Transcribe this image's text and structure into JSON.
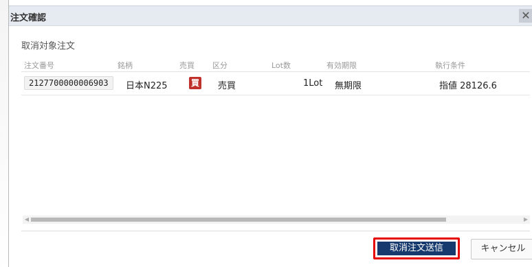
{
  "dialog": {
    "title": "注文確認",
    "close_glyph": "✕",
    "subtitle": "取消対象注文"
  },
  "table": {
    "columns": [
      "注文番号",
      "銘柄",
      "売買",
      "区分",
      "Lot数",
      "有効期限",
      "執行条件"
    ],
    "rows": [
      {
        "order_no": "2127700000006903",
        "symbol": "日本N225",
        "side_badge": "買",
        "category": "売買",
        "lots": "1Lot",
        "expiry": "無期限",
        "condition": "指値 28126.6"
      }
    ]
  },
  "scrollbar": {
    "left_arrow": "◀",
    "right_arrow": "▶",
    "position": 0.0
  },
  "buttons": {
    "submit_cancel": "取消注文送信",
    "cancel": "キャンセル"
  },
  "colors": {
    "buy_badge": "#c0312b",
    "primary_button": "#173a6e",
    "highlight_border": "#e60000",
    "titlebar": "#e6ebf2"
  },
  "icons": {
    "close": "close-icon",
    "scroll_left": "scroll-left-icon",
    "scroll_right": "scroll-right-icon"
  }
}
